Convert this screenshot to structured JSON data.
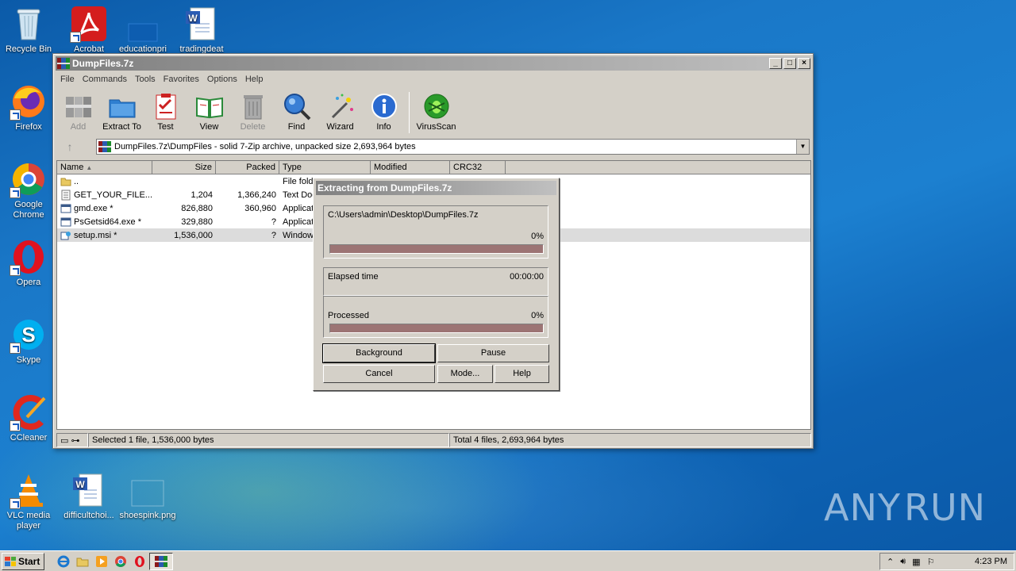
{
  "desktop": {
    "icons": [
      {
        "name": "recycle-bin",
        "label": "Recycle Bin"
      },
      {
        "name": "acrobat",
        "label": "Acrobat"
      },
      {
        "name": "educationpri",
        "label": "educationpri"
      },
      {
        "name": "tradingdeat",
        "label": "tradingdeat"
      },
      {
        "name": "firefox",
        "label": "Firefox"
      },
      {
        "name": "google-chrome",
        "label": "Google Chrome"
      },
      {
        "name": "opera",
        "label": "Opera"
      },
      {
        "name": "skype",
        "label": "Skype"
      },
      {
        "name": "ccleaner",
        "label": "CCleaner"
      },
      {
        "name": "vlc",
        "label": "VLC media player"
      },
      {
        "name": "difficultchoi",
        "label": "difficultchoi..."
      },
      {
        "name": "shoespink",
        "label": "shoespink.png"
      }
    ],
    "watermark": {
      "left": "ANY",
      "right": "RUN"
    }
  },
  "window": {
    "title": "DumpFiles.7z",
    "menu": [
      "File",
      "Commands",
      "Tools",
      "Favorites",
      "Options",
      "Help"
    ],
    "toolbar": [
      {
        "label": "Add",
        "icon": "add-icon",
        "disabled": true
      },
      {
        "label": "Extract To",
        "icon": "extract-icon",
        "disabled": false
      },
      {
        "label": "Test",
        "icon": "test-icon",
        "disabled": false
      },
      {
        "label": "View",
        "icon": "view-icon",
        "disabled": false
      },
      {
        "label": "Delete",
        "icon": "delete-icon",
        "disabled": true
      },
      {
        "label": "Find",
        "icon": "find-icon",
        "disabled": false
      },
      {
        "label": "Wizard",
        "icon": "wizard-icon",
        "disabled": false
      },
      {
        "label": "Info",
        "icon": "info-icon",
        "disabled": false
      },
      {
        "label": "VirusScan",
        "icon": "virusscan-icon",
        "disabled": false
      }
    ],
    "address": "DumpFiles.7z\\DumpFiles - solid 7-Zip archive, unpacked size 2,693,964 bytes",
    "columns": {
      "name": "Name",
      "size": "Size",
      "packed": "Packed",
      "type": "Type",
      "modified": "Modified",
      "crc": "CRC32"
    },
    "rows": [
      {
        "name": "..",
        "size": "",
        "packed": "",
        "type": "File folde",
        "icon": "folder-icon"
      },
      {
        "name": "GET_YOUR_FILE...",
        "size": "1,204",
        "packed": "1,366,240",
        "type": "Text Doc",
        "icon": "text-file-icon"
      },
      {
        "name": "gmd.exe *",
        "size": "826,880",
        "packed": "360,960",
        "type": "Applicat",
        "icon": "exe-icon"
      },
      {
        "name": "PsGetsid64.exe *",
        "size": "329,880",
        "packed": "?",
        "type": "Applicat",
        "icon": "exe-icon"
      },
      {
        "name": "setup.msi *",
        "size": "1,536,000",
        "packed": "?",
        "type": "Window",
        "icon": "msi-icon"
      }
    ],
    "status_left": "Selected 1 file, 1,536,000 bytes",
    "status_right": "Total 4 files, 2,693,964 bytes"
  },
  "dialog": {
    "title": "Extracting from DumpFiles.7z",
    "path": "C:\\Users\\admin\\Desktop\\DumpFiles.7z",
    "file_percent": "0%",
    "file_progress": 0,
    "elapsed_label": "Elapsed time",
    "elapsed_value": "00:00:00",
    "processed_label": "Processed",
    "processed_percent": "0%",
    "processed_progress": 0,
    "buttons": {
      "background": "Background",
      "pause": "Pause",
      "cancel": "Cancel",
      "mode": "Mode...",
      "help": "Help"
    }
  },
  "taskbar": {
    "start": "Start",
    "clock": "4:23 PM"
  }
}
